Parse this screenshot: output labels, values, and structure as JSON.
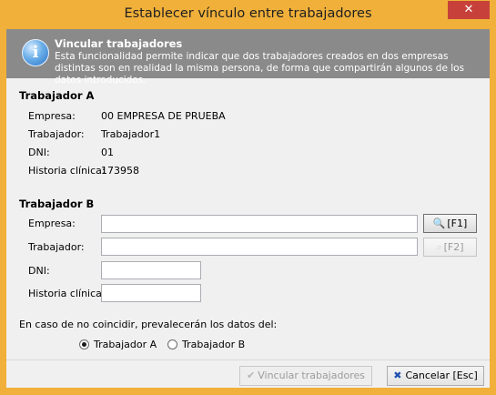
{
  "window": {
    "title": "Establecer vínculo entre trabajadores",
    "close_label": "✕"
  },
  "banner": {
    "icon": "info-icon",
    "title": "Vincular trabajadores",
    "text": "Esta funcionalidad permite indicar que dos trabajadores creados en dos empresas distintas son en realidad la misma persona, de forma que compartirán algunos de los datos introducidos."
  },
  "worker_a": {
    "title": "Trabajador A",
    "empresa_label": "Empresa:",
    "empresa_value": "00 EMPRESA DE PRUEBA",
    "trabajador_label": "Trabajador:",
    "trabajador_value": "Trabajador1",
    "dni_label": "DNI:",
    "dni_value": "01",
    "historia_label": "Historia clínica:",
    "historia_value": "173958"
  },
  "worker_b": {
    "title": "Trabajador B",
    "empresa_label": "Empresa:",
    "empresa_value": "",
    "trabajador_label": "Trabajador:",
    "trabajador_value": "",
    "dni_label": "DNI:",
    "dni_value": "",
    "historia_label": "Historia clínica:",
    "historia_value": "",
    "search_empresa_label": "[F1]",
    "search_trabajador_label": "[F2]"
  },
  "priority": {
    "question": "En caso de no coincidir, prevalecerán los datos del:",
    "option_a": "Trabajador A",
    "option_b": "Trabajador B",
    "selected": "Trabajador A"
  },
  "footer": {
    "link_label": "Vincular trabajadores",
    "cancel_label": "Cancelar [Esc]"
  },
  "colors": {
    "title_bar": "#f0b03a",
    "banner": "#8a8a8a",
    "close": "#c7413a"
  }
}
